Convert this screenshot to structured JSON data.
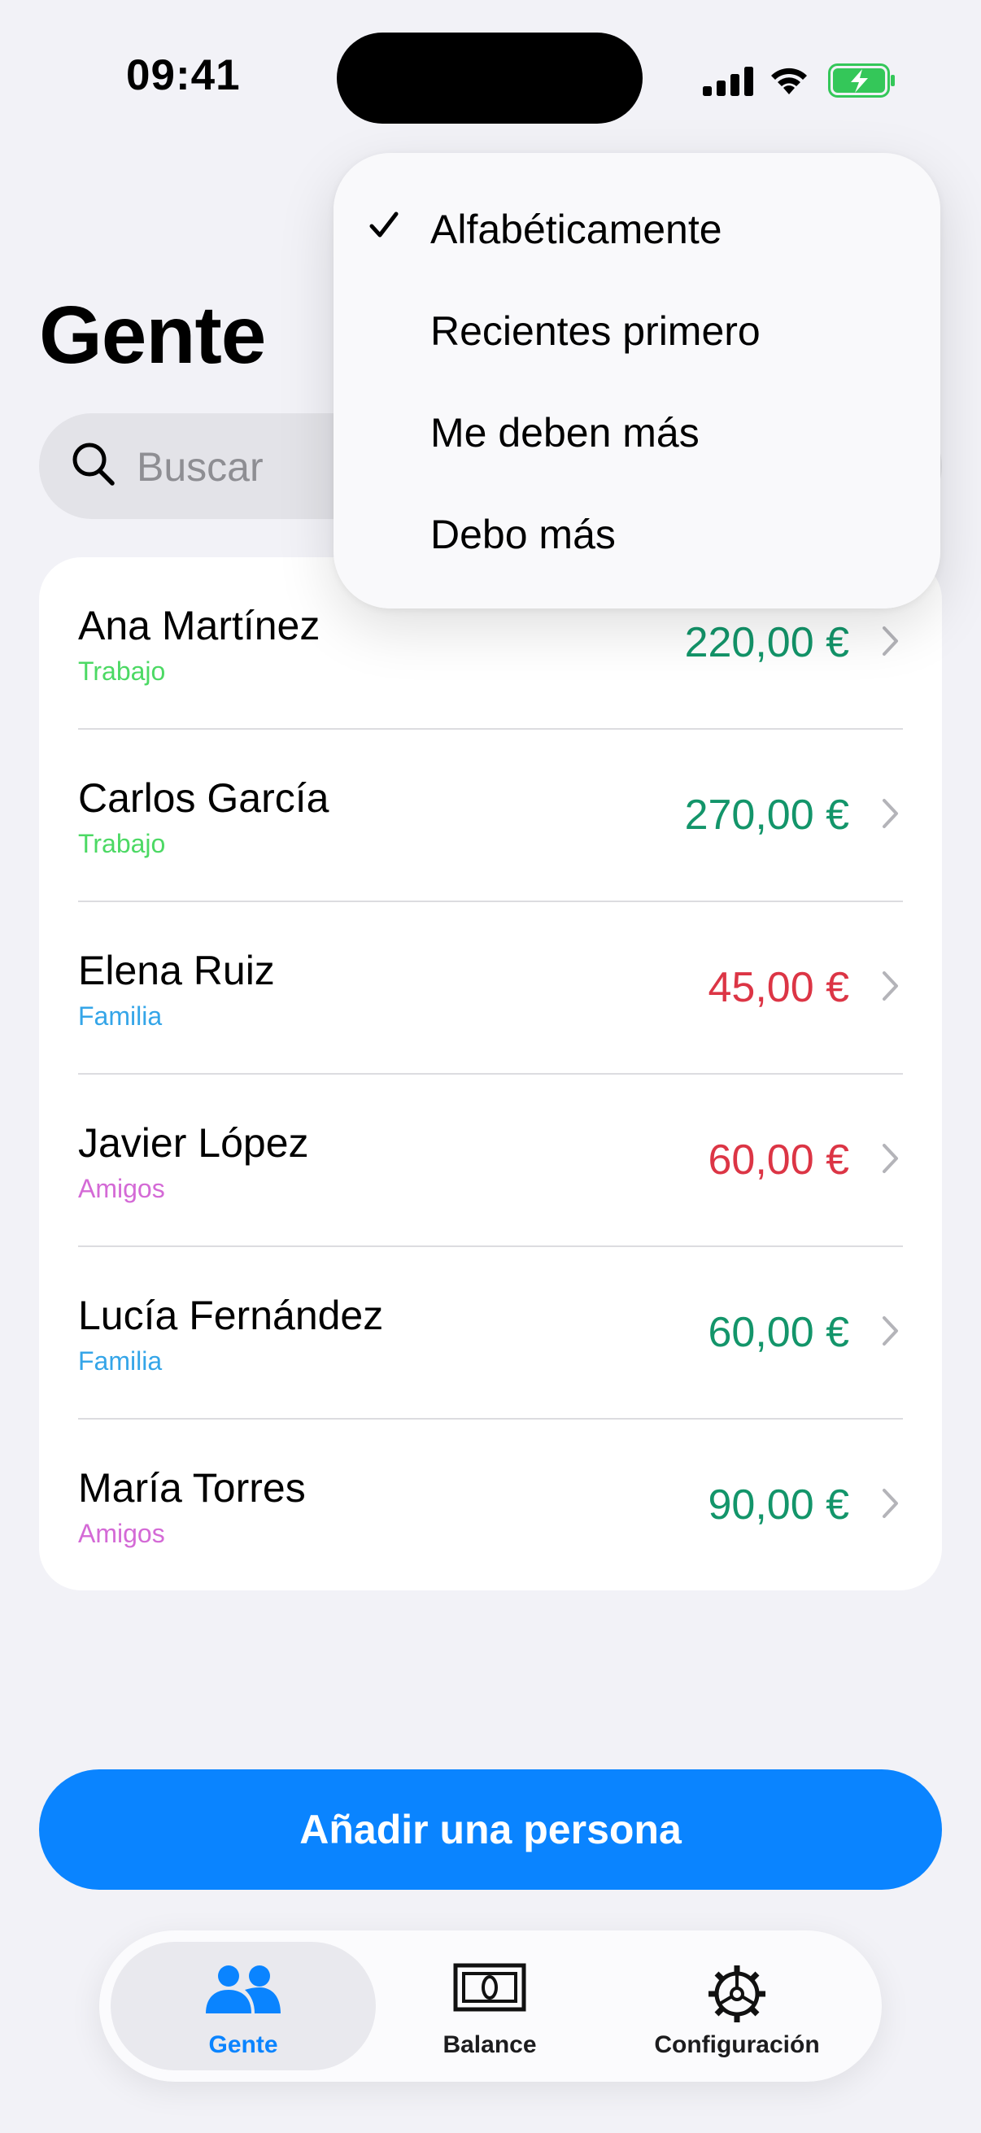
{
  "status_bar": {
    "time": "09:41"
  },
  "page": {
    "title": "Gente"
  },
  "search": {
    "placeholder": "Buscar"
  },
  "sort_menu": {
    "items": [
      {
        "label": "Alfabéticamente",
        "selected": true
      },
      {
        "label": "Recientes primero",
        "selected": false
      },
      {
        "label": "Me deben más",
        "selected": false
      },
      {
        "label": "Debo más",
        "selected": false
      }
    ]
  },
  "people": [
    {
      "name": "Ana Martínez",
      "tag": "Trabajo",
      "amount": "220,00 €",
      "tag_color": "#4cd964",
      "amount_color": "#13956a"
    },
    {
      "name": "Carlos García",
      "tag": "Trabajo",
      "amount": "270,00 €",
      "tag_color": "#4cd964",
      "amount_color": "#13956a"
    },
    {
      "name": "Elena Ruiz",
      "tag": "Familia",
      "amount": "45,00 €",
      "tag_color": "#34a5e8",
      "amount_color": "#dc3545"
    },
    {
      "name": "Javier López",
      "tag": "Amigos",
      "amount": "60,00 €",
      "tag_color": "#d46ad6",
      "amount_color": "#dc3545"
    },
    {
      "name": "Lucía Fernández",
      "tag": "Familia",
      "amount": "60,00 €",
      "tag_color": "#34a5e8",
      "amount_color": "#13956a"
    },
    {
      "name": "María Torres",
      "tag": "Amigos",
      "amount": "90,00 €",
      "tag_color": "#d46ad6",
      "amount_color": "#13956a"
    }
  ],
  "actions": {
    "add_person": "Añadir una persona"
  },
  "tab_bar": {
    "tabs": [
      {
        "label": "Gente",
        "icon": "people-icon",
        "active": true
      },
      {
        "label": "Balance",
        "icon": "banknote-icon",
        "active": false
      },
      {
        "label": "Configuración",
        "icon": "gear-icon",
        "active": false
      }
    ]
  },
  "colors": {
    "accent": "#0a84ff",
    "positive": "#13956a",
    "negative": "#dc3545"
  }
}
